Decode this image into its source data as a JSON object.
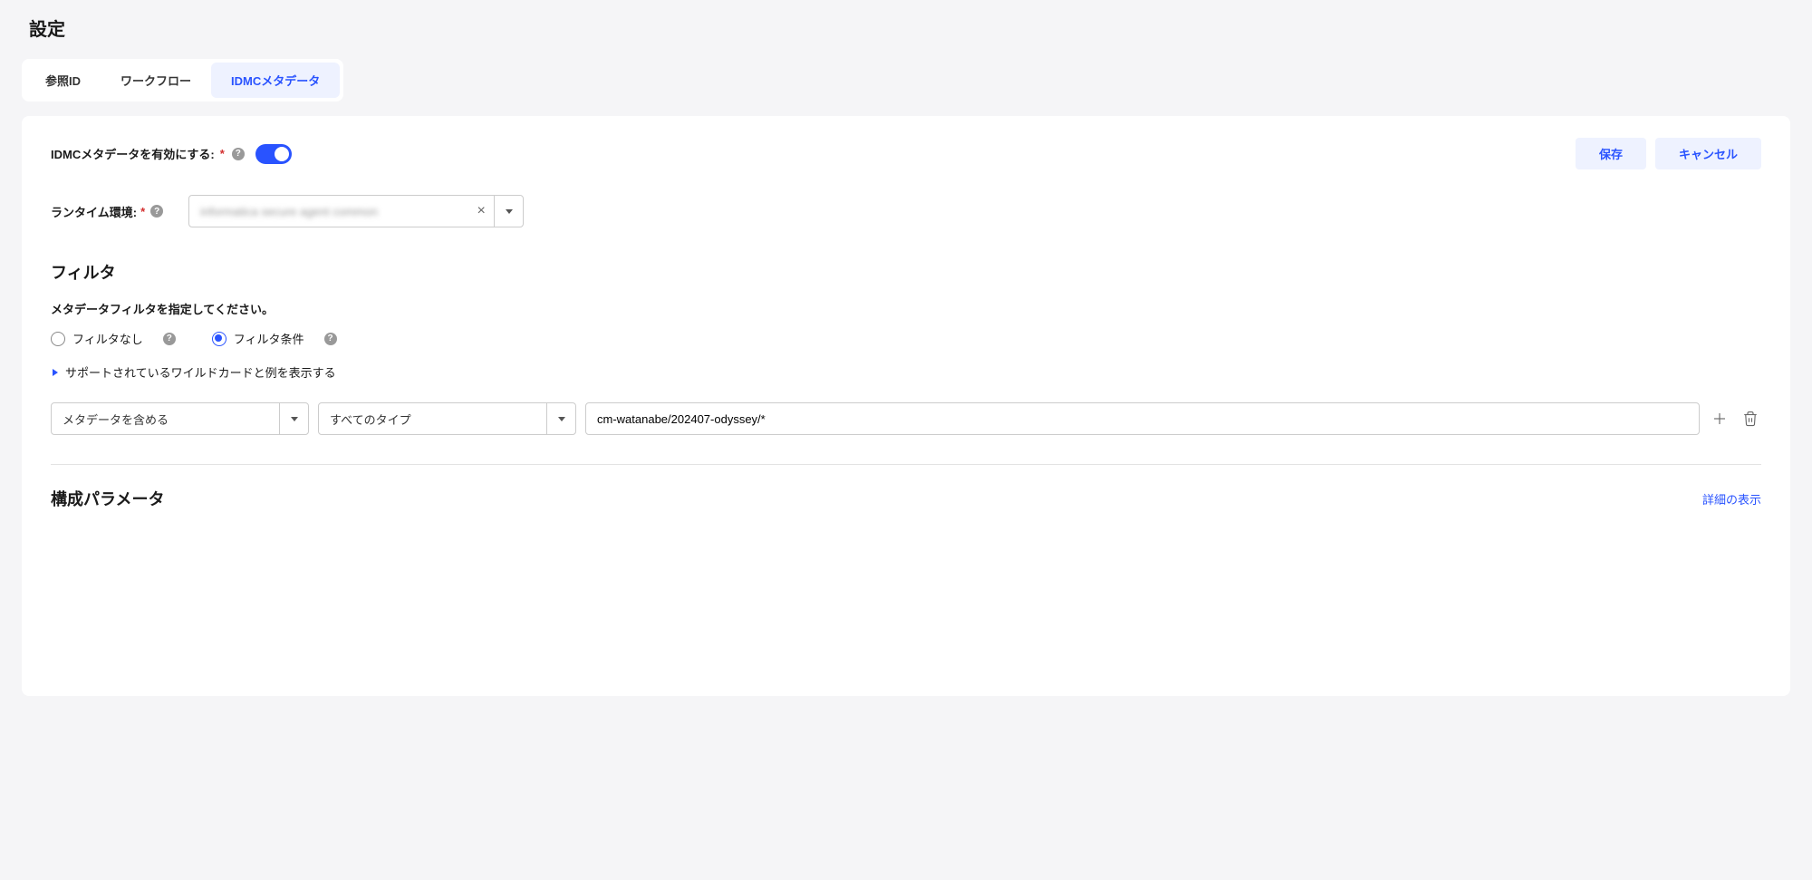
{
  "header": {
    "title": "設定"
  },
  "tabs": [
    {
      "label": "参照ID",
      "active": false
    },
    {
      "label": "ワークフロー",
      "active": false
    },
    {
      "label": "IDMCメタデータ",
      "active": true
    }
  ],
  "enable": {
    "label": "IDMCメタデータを有効にする:",
    "required": "*"
  },
  "actions": {
    "save": "保存",
    "cancel": "キャンセル"
  },
  "runtime": {
    "label": "ランタイム環境:",
    "required": "*",
    "value": "informatica secure agent common"
  },
  "filter": {
    "title": "フィルタ",
    "subtitle": "メタデータフィルタを指定してください。",
    "radio_none": "フィルタなし",
    "radio_cond": "フィルタ条件",
    "wildcard_link": "サポートされているワイルドカードと例を表示する",
    "include_label": "メタデータを含める",
    "type_label": "すべてのタイプ",
    "path_value": "cm-watanabe/202407-odyssey/*"
  },
  "params": {
    "title": "構成パラメータ",
    "detail": "詳細の表示"
  }
}
